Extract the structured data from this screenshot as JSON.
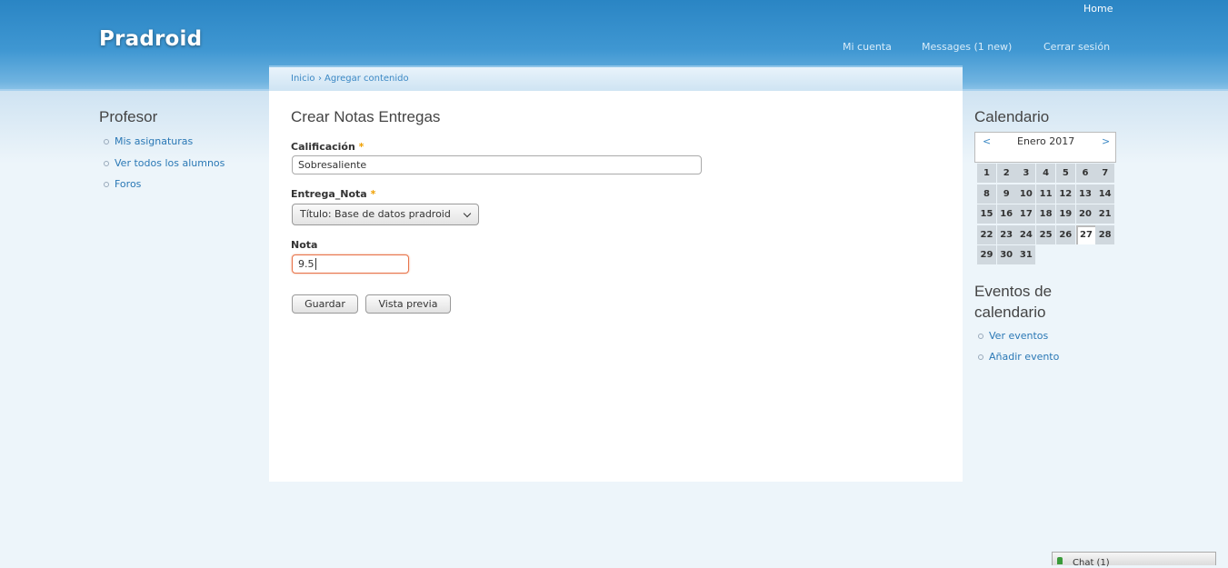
{
  "site": {
    "name": "Pradroid"
  },
  "top_nav": {
    "home": "Home"
  },
  "user_nav": {
    "account": "Mi cuenta",
    "messages": "Messages (1 new)",
    "logout": "Cerrar sesión"
  },
  "breadcrumb": {
    "home": "Inicio",
    "separator": "›",
    "current": "Agregar contenido"
  },
  "form": {
    "title": "Crear Notas Entregas",
    "calificacion": {
      "label": "Calificación",
      "required": "*",
      "value": "Sobresaliente"
    },
    "entrega": {
      "label": "Entrega_Nota",
      "required": "*",
      "selected": "Título: Base de datos pradroid"
    },
    "nota": {
      "label": "Nota",
      "value": "9.5"
    },
    "buttons": {
      "save": "Guardar",
      "preview": "Vista previa"
    }
  },
  "left_sidebar": {
    "title": "Profesor",
    "items": [
      "Mis asignaturas",
      "Ver todos los alumnos",
      "Foros"
    ]
  },
  "calendar": {
    "title": "Calendario",
    "prev": "<",
    "next": ">",
    "month": "Enero 2017",
    "days": [
      "1",
      "2",
      "3",
      "4",
      "5",
      "6",
      "7",
      "8",
      "9",
      "10",
      "11",
      "12",
      "13",
      "14",
      "15",
      "16",
      "17",
      "18",
      "19",
      "20",
      "21",
      "22",
      "23",
      "24",
      "25",
      "26",
      "27",
      "28",
      "29",
      "30",
      "31"
    ],
    "today": "27"
  },
  "events": {
    "title_line1": "Eventos de",
    "title_line2": "calendario",
    "items": [
      "Ver eventos",
      "Añadir evento"
    ]
  },
  "chat": {
    "label": "Chat (1)"
  },
  "colors": {
    "header": "#2a85c4",
    "link": "#2a78b5",
    "required": "#f0a000",
    "input_focus": "#e8734a"
  },
  "icons": [
    "chat-icon",
    "chevron-down-icon"
  ]
}
